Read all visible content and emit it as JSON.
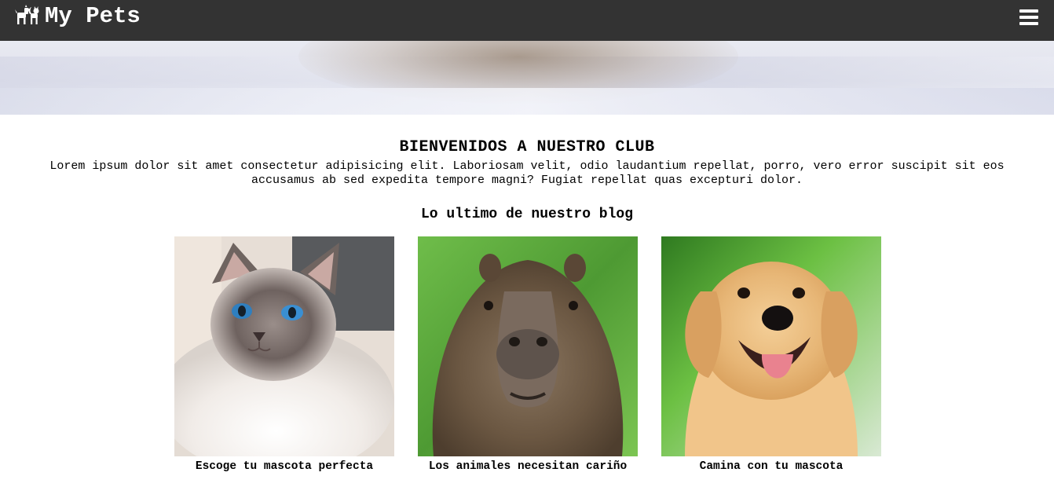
{
  "navbar": {
    "brand": "My Pets",
    "brand_icon": "pets-icon",
    "menu_icon": "hamburger-menu-icon",
    "background": "#333333"
  },
  "hero": {
    "image": "blurred-pet-banner"
  },
  "welcome": {
    "title": "BIENVENIDOS A NUESTRO CLUB",
    "text": "Lorem ipsum dolor sit amet consectetur adipisicing elit. Laboriosam velit, odio laudantium repellat, porro, vero error suscipit sit eos accusamus ab sed expedita tempore magni? Fugiat repellat quas excepturi dolor."
  },
  "blog": {
    "title": "Lo ultimo de nuestro blog",
    "posts": [
      {
        "caption": "Escoge tu mascota perfecta",
        "image": "cat-photo"
      },
      {
        "caption": "Los animales necesitan cariño",
        "image": "capybara-photo"
      },
      {
        "caption": "Camina con tu mascota",
        "image": "dog-photo"
      }
    ]
  }
}
